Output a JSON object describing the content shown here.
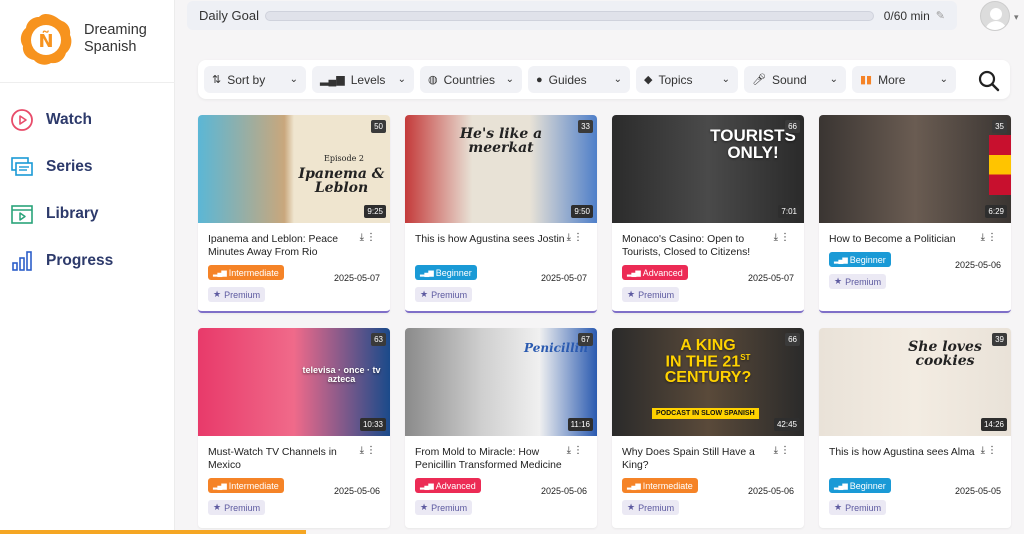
{
  "brand": {
    "line1": "Dreaming",
    "line2": "Spanish",
    "logo_letter": "Ñ",
    "color": "#f7931e"
  },
  "nav": [
    {
      "label": "Watch",
      "icon": "play-circle-icon"
    },
    {
      "label": "Series",
      "icon": "stacked-screens-icon"
    },
    {
      "label": "Library",
      "icon": "library-play-icon"
    },
    {
      "label": "Progress",
      "icon": "bar-chart-icon"
    }
  ],
  "goal": {
    "label": "Daily Goal",
    "value": "0/60 min",
    "progress": 0.0
  },
  "filters": [
    {
      "label": "Sort by",
      "icon": "sort-icon"
    },
    {
      "label": "Levels",
      "icon": "signal-bars-icon"
    },
    {
      "label": "Countries",
      "icon": "globe-icon"
    },
    {
      "label": "Guides",
      "icon": "person-icon"
    },
    {
      "label": "Topics",
      "icon": "tag-icon"
    },
    {
      "label": "Sound",
      "icon": "microphone-icon"
    },
    {
      "label": "More",
      "icon": "more-filters-icon"
    }
  ],
  "premium_label": "Premium",
  "videos": [
    {
      "title": "Ipanema and Leblon: Peace Minutes Away From Rio",
      "level": "Intermediate",
      "date": "2025-05-07",
      "count": "50",
      "duration": "9:25",
      "thumb_text": "Episode 2 · Ipanema & Leblon"
    },
    {
      "title": "This is how Agustina sees Jostin",
      "level": "Beginner",
      "date": "2025-05-07",
      "count": "33",
      "duration": "9:50",
      "thumb_text": "He's like a meerkat"
    },
    {
      "title": "Monaco's Casino: Open to Tourists, Closed to Citizens!",
      "level": "Advanced",
      "date": "2025-05-07",
      "count": "66",
      "duration": "7:01",
      "thumb_text": "TOURISTS ONLY!"
    },
    {
      "title": "How to Become a Politician",
      "level": "Beginner",
      "date": "2025-05-06",
      "count": "35",
      "duration": "6:29",
      "thumb_text": ""
    },
    {
      "title": "Must-Watch TV Channels in Mexico",
      "level": "Intermediate",
      "date": "2025-05-06",
      "count": "63",
      "duration": "10:33",
      "thumb_text": "televisa · once méxico · tv azteca"
    },
    {
      "title": "From Mold to Miracle: How Penicillin Transformed Medicine",
      "level": "Advanced",
      "date": "2025-05-06",
      "count": "67",
      "duration": "11:16",
      "thumb_text": "Penicillin"
    },
    {
      "title": "Why Does Spain Still Have a King?",
      "level": "Intermediate",
      "date": "2025-05-06",
      "count": "66",
      "duration": "42:45",
      "thumb_text": "A KING IN THE 21ST CENTURY? · PODCAST IN SLOW SPANISH"
    },
    {
      "title": "This is how Agustina sees Alma",
      "level": "Beginner",
      "date": "2025-05-05",
      "count": "39",
      "duration": "14:26",
      "thumb_text": "She loves cookies"
    }
  ]
}
